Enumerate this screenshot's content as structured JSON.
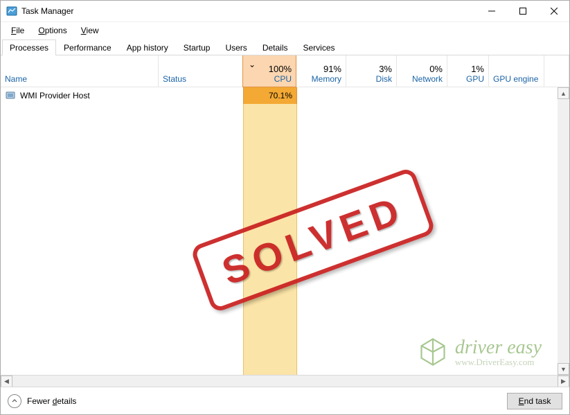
{
  "window": {
    "title": "Task Manager"
  },
  "menu": {
    "file": "File",
    "options": "Options",
    "view": "View"
  },
  "tabs": {
    "processes": "Processes",
    "performance": "Performance",
    "app_history": "App history",
    "startup": "Startup",
    "users": "Users",
    "details": "Details",
    "services": "Services"
  },
  "columns": {
    "name": "Name",
    "status": "Status",
    "cpu": {
      "value": "100%",
      "label": "CPU"
    },
    "memory": {
      "value": "91%",
      "label": "Memory"
    },
    "disk": {
      "value": "3%",
      "label": "Disk"
    },
    "network": {
      "value": "0%",
      "label": "Network"
    },
    "gpu": {
      "value": "1%",
      "label": "GPU"
    },
    "gpu_engine": "GPU engine"
  },
  "rows": [
    {
      "name": "WMI Provider Host",
      "cpu": "70.1%"
    }
  ],
  "footer": {
    "fewer_details": "Fewer details",
    "end_task": "End task"
  },
  "overlay": {
    "stamp": "SOLVED",
    "watermark_brand": "driver easy",
    "watermark_url": "www.DriverEasy.com"
  }
}
